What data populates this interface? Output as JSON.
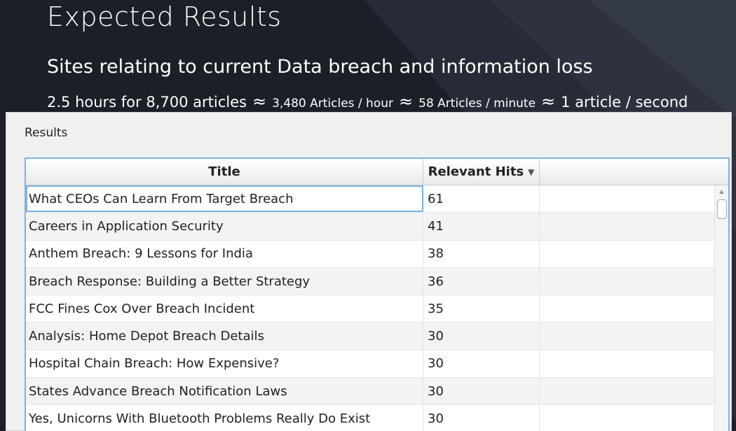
{
  "slide": {
    "title": "Expected Results",
    "subtitle": "Sites relating to current Data breach and information loss",
    "stats": {
      "part1": "2.5 hours for 8,700 articles",
      "part2": "3,480 Articles / hour",
      "part3": "58 Articles / minute",
      "part4": "1 article / second",
      "approx_symbol": "≈"
    }
  },
  "results": {
    "label": "Results",
    "columns": {
      "title": "Title",
      "hits": "Relevant Hits",
      "sort_indicator": "▼"
    },
    "rows": [
      {
        "title": "What CEOs Can Learn From Target Breach",
        "hits": "61"
      },
      {
        "title": "Careers in Application Security",
        "hits": "41"
      },
      {
        "title": "Anthem Breach: 9 Lessons for India",
        "hits": "38"
      },
      {
        "title": "Breach Response: Building a Better Strategy",
        "hits": "36"
      },
      {
        "title": "FCC Fines Cox Over Breach Incident",
        "hits": "35"
      },
      {
        "title": "Analysis: Home Depot Breach Details",
        "hits": "30"
      },
      {
        "title": "Hospital Chain Breach: How Expensive?",
        "hits": "30"
      },
      {
        "title": "States Advance Breach Notification Laws",
        "hits": "30"
      },
      {
        "title": "Yes, Unicorns With Bluetooth Problems Really Do Exist",
        "hits": "30"
      }
    ]
  },
  "colors": {
    "background": "#1b1f27",
    "selection_border": "#7fb2e0"
  }
}
